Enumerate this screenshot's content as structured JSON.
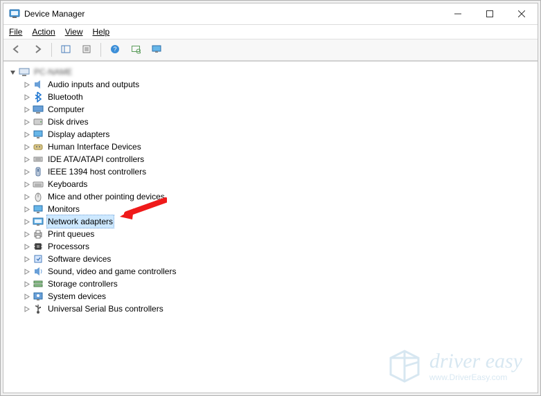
{
  "window": {
    "title": "Device Manager"
  },
  "menu": {
    "file": "File",
    "action": "Action",
    "view": "View",
    "help": "Help"
  },
  "tree": {
    "root": "PC-NAME",
    "items": [
      {
        "label": "Audio inputs and outputs",
        "icon": "speaker"
      },
      {
        "label": "Bluetooth",
        "icon": "bluetooth"
      },
      {
        "label": "Computer",
        "icon": "computer"
      },
      {
        "label": "Disk drives",
        "icon": "disk"
      },
      {
        "label": "Display adapters",
        "icon": "display"
      },
      {
        "label": "Human Interface Devices",
        "icon": "hid"
      },
      {
        "label": "IDE ATA/ATAPI controllers",
        "icon": "ide"
      },
      {
        "label": "IEEE 1394 host controllers",
        "icon": "ieee1394"
      },
      {
        "label": "Keyboards",
        "icon": "keyboard"
      },
      {
        "label": "Mice and other pointing devices",
        "icon": "mouse"
      },
      {
        "label": "Monitors",
        "icon": "monitor"
      },
      {
        "label": "Network adapters",
        "icon": "network",
        "selected": true
      },
      {
        "label": "Print queues",
        "icon": "printer"
      },
      {
        "label": "Processors",
        "icon": "cpu"
      },
      {
        "label": "Software devices",
        "icon": "software"
      },
      {
        "label": "Sound, video and game controllers",
        "icon": "sound"
      },
      {
        "label": "Storage controllers",
        "icon": "storage"
      },
      {
        "label": "System devices",
        "icon": "system"
      },
      {
        "label": "Universal Serial Bus controllers",
        "icon": "usb"
      }
    ]
  },
  "watermark": {
    "brand": "driver easy",
    "url": "www.DriverEasy.com"
  }
}
